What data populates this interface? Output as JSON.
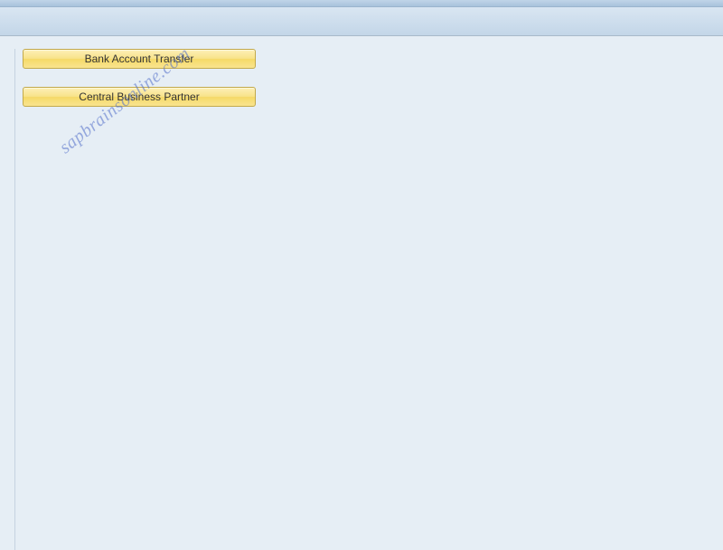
{
  "buttons": {
    "bank_transfer": "Bank Account Transfer",
    "central_bp": "Central Business Partner"
  },
  "watermark": "sapbrainsonline.com"
}
